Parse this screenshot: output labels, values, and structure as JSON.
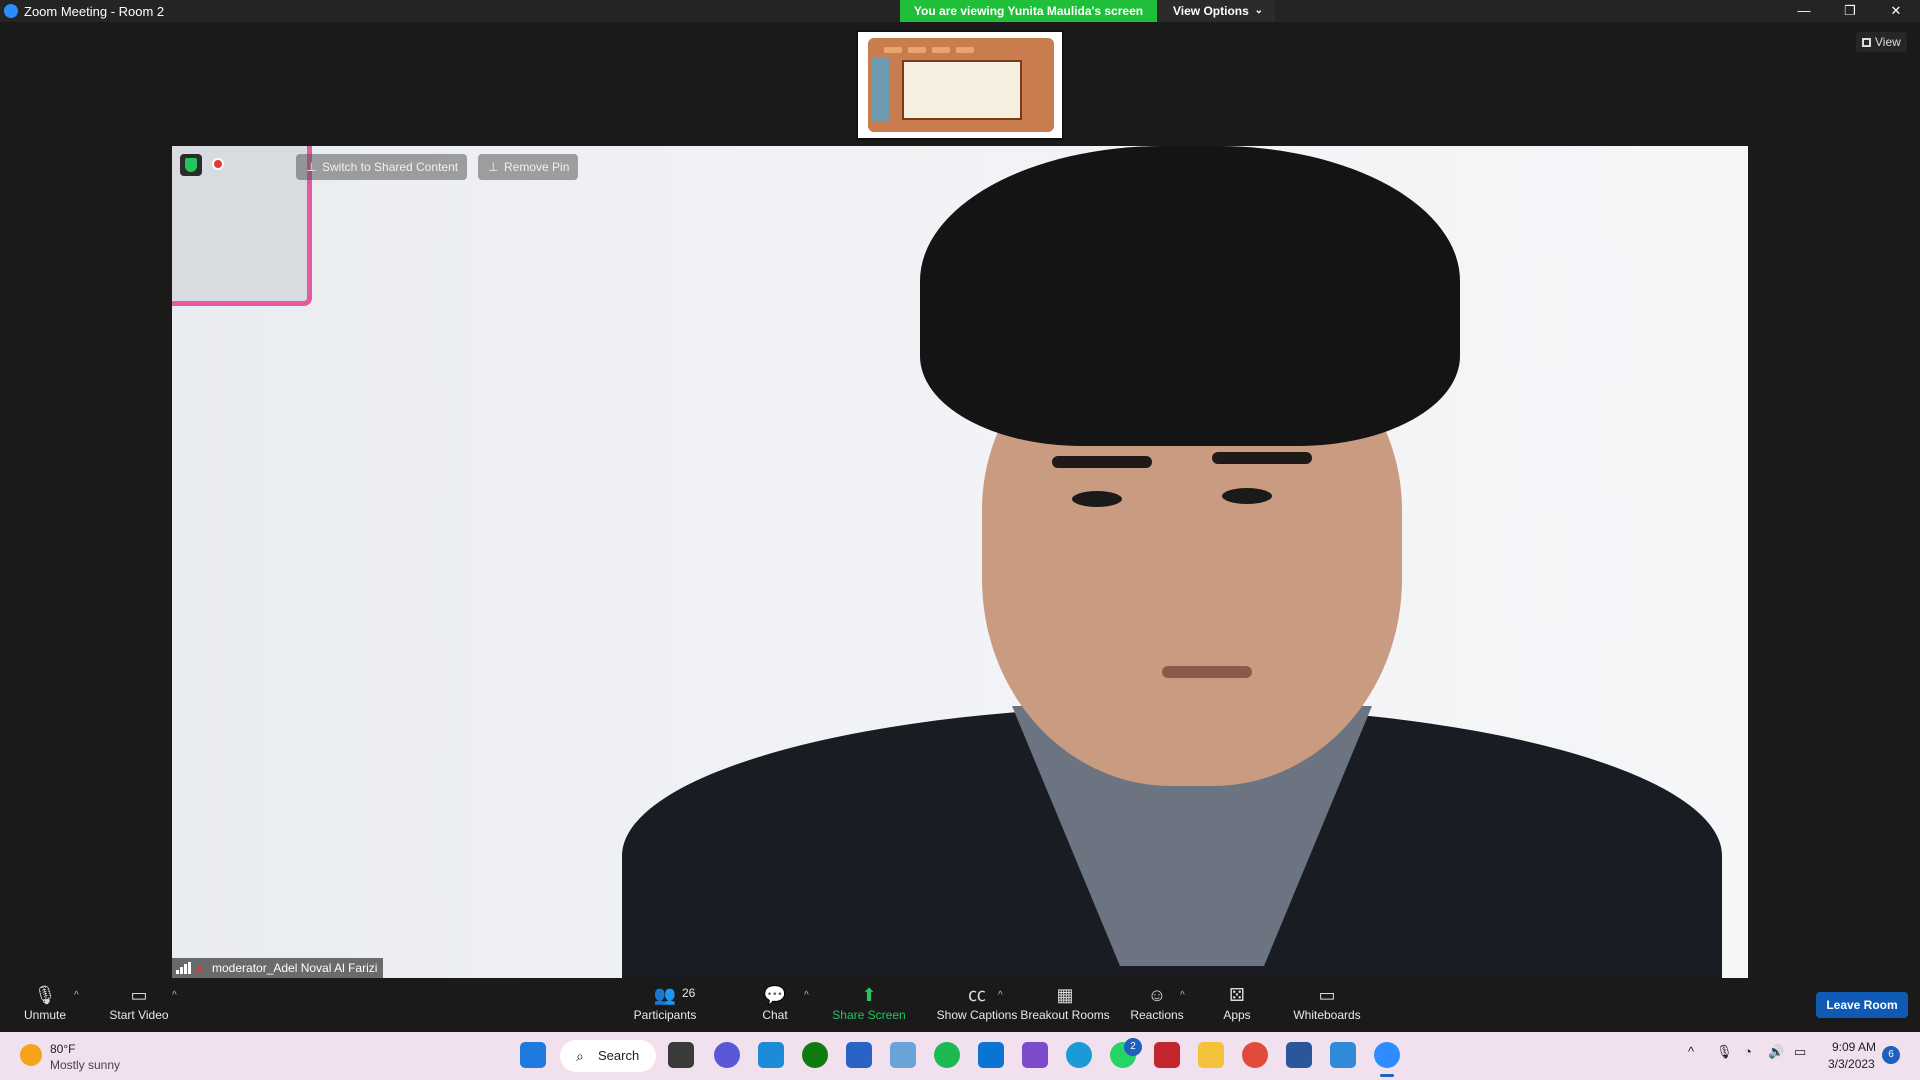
{
  "window": {
    "title": "Zoom Meeting - Room 2",
    "share_banner": "You are viewing Yunita Maulida's screen",
    "view_options": "View Options",
    "minimize": "—",
    "restore": "❐",
    "close": "✕"
  },
  "stage": {
    "view_label": "View",
    "switch_label": "Switch to Shared Content",
    "remove_pin_label": "Remove Pin",
    "participant_name": "moderator_Adel Noval Al Farizi"
  },
  "toolbar": {
    "unmute": "Unmute",
    "start_video": "Start Video",
    "participants": "Participants",
    "participants_count": "26",
    "chat": "Chat",
    "share_screen": "Share Screen",
    "show_captions": "Show Captions",
    "breakout_rooms": "Breakout Rooms",
    "reactions": "Reactions",
    "apps": "Apps",
    "whiteboards": "Whiteboards",
    "leave_room": "Leave Room"
  },
  "taskbar": {
    "temperature": "80°F",
    "weather": "Mostly sunny",
    "search": "Search",
    "time": "9:09 AM",
    "date": "3/3/2023",
    "notifications": "6",
    "whatsapp_badge": "2"
  },
  "colors": {
    "share_green": "#1fbf3a",
    "leave_blue": "#0e5ab5",
    "taskbar_bg": "#f1e0ee"
  }
}
